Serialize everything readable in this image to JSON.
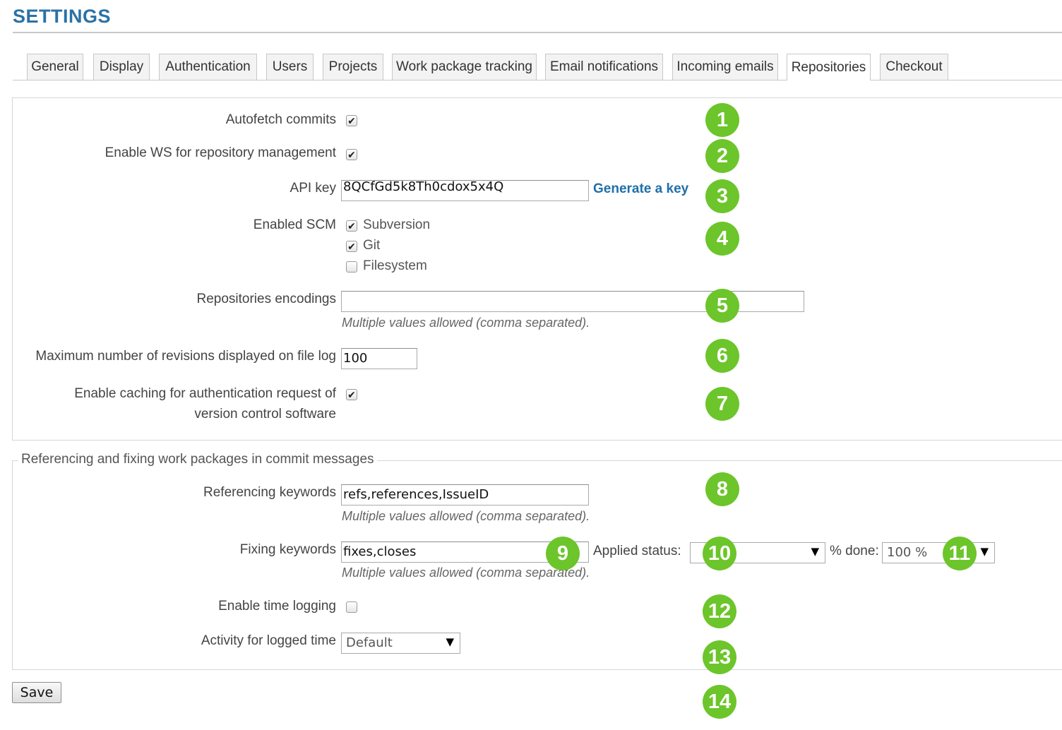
{
  "header": {
    "title": "SETTINGS"
  },
  "tabs": [
    {
      "label": "General"
    },
    {
      "label": "Display"
    },
    {
      "label": "Authentication"
    },
    {
      "label": "Users"
    },
    {
      "label": "Projects"
    },
    {
      "label": "Work package tracking"
    },
    {
      "label": "Email notifications"
    },
    {
      "label": "Incoming emails"
    },
    {
      "label": "Repositories",
      "active": true
    },
    {
      "label": "Checkout"
    }
  ],
  "repo": {
    "autofetch_label": "Autofetch commits",
    "autofetch_checked": true,
    "ws_label": "Enable WS for repository management",
    "ws_checked": true,
    "api_key_label": "API key",
    "api_key_value": "8QCfGd5k8Th0cdox5x4Q",
    "generate_key_link": "Generate a key",
    "scm_label": "Enabled SCM",
    "scm_options": [
      {
        "label": "Subversion",
        "checked": true
      },
      {
        "label": "Git",
        "checked": true
      },
      {
        "label": "Filesystem",
        "checked": false
      }
    ],
    "encodings_label": "Repositories encodings",
    "encodings_value": "",
    "encodings_hint": "Multiple values allowed (comma separated).",
    "max_revisions_label": "Maximum number of revisions displayed on file log",
    "max_revisions_value": "100",
    "caching_label_line1": "Enable caching for authentication request of",
    "caching_label_line2": "version control software",
    "caching_checked": true
  },
  "commit": {
    "legend": "Referencing and fixing work packages in commit messages",
    "referencing_label": "Referencing keywords",
    "referencing_value": "refs,references,IssueID",
    "referencing_hint": "Multiple values allowed (comma separated).",
    "fixing_label": "Fixing keywords",
    "fixing_value": "fixes,closes",
    "fixing_hint": "Multiple values allowed (comma separated).",
    "applied_status_label": "Applied status:",
    "applied_status_value": "",
    "done_label": "% done:",
    "done_value": "100 %",
    "time_logging_label": "Enable time logging",
    "time_logging_checked": false,
    "activity_label": "Activity for logged time",
    "activity_value": "Default"
  },
  "actions": {
    "save_label": "Save"
  },
  "markers": [
    "1",
    "2",
    "3",
    "4",
    "5",
    "6",
    "7",
    "8",
    "9",
    "10",
    "11",
    "12",
    "13",
    "14"
  ],
  "icons": {
    "checkbox_check": "checkmark-icon",
    "dropdown_arrow": "triangle-down-icon"
  },
  "colors": {
    "title": "#2a72a6",
    "link": "#1f6fa8",
    "marker": "#6cc52a"
  }
}
